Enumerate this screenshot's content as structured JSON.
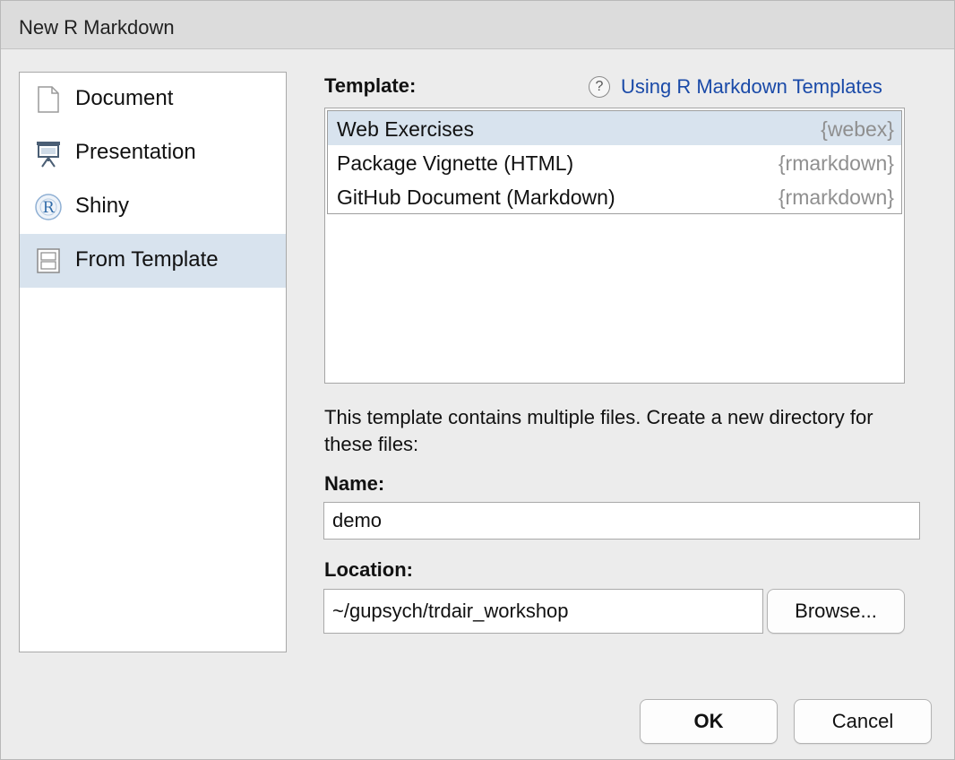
{
  "window": {
    "title": "New R Markdown"
  },
  "sidebar": {
    "items": [
      {
        "label": "Document",
        "icon": "document-icon",
        "selected": false
      },
      {
        "label": "Presentation",
        "icon": "presentation-icon",
        "selected": false
      },
      {
        "label": "Shiny",
        "icon": "shiny-icon",
        "selected": false
      },
      {
        "label": "From Template",
        "icon": "template-icon",
        "selected": true
      }
    ]
  },
  "template": {
    "label": "Template:",
    "help_link": "Using R Markdown Templates",
    "help_icon": "?",
    "items": [
      {
        "name": "Web Exercises",
        "package": "{webex}",
        "selected": true
      },
      {
        "name": "Package Vignette (HTML)",
        "package": "{rmarkdown}",
        "selected": false
      },
      {
        "name": "GitHub Document (Markdown)",
        "package": "{rmarkdown}",
        "selected": false
      }
    ]
  },
  "description": "This template contains multiple files. Create a new directory for these files:",
  "name_field": {
    "label": "Name:",
    "value": "demo"
  },
  "location_field": {
    "label": "Location:",
    "value": "~/gupsych/trdair_workshop"
  },
  "buttons": {
    "browse": "Browse...",
    "ok": "OK",
    "cancel": "Cancel"
  },
  "colors": {
    "selection": "#d8e3ee",
    "link": "#1a4aa8",
    "package_text": "#8f8f8f"
  }
}
